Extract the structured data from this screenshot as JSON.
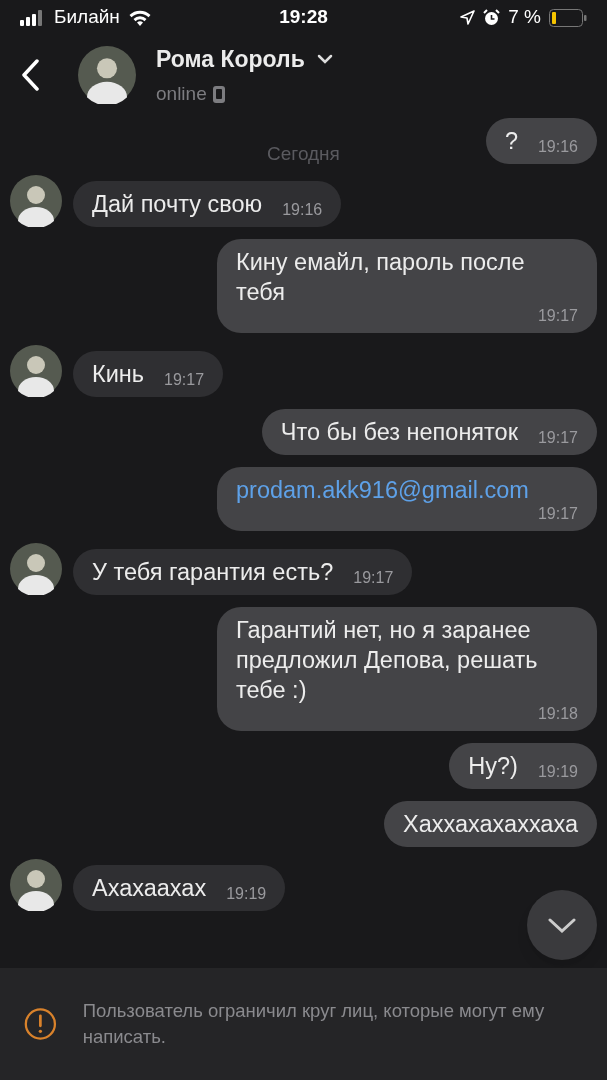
{
  "status_bar": {
    "carrier": "Билайн",
    "time": "19:28",
    "battery": "7 %"
  },
  "header": {
    "name": "Рома Король",
    "status": "online"
  },
  "date_separator": "Сегодня",
  "messages": [
    {
      "outgoing": true,
      "kind": "text",
      "text": "?",
      "time": "19:16"
    },
    {
      "outgoing": false,
      "kind": "text",
      "text": "Дай почту свою",
      "time": "19:16"
    },
    {
      "outgoing": true,
      "kind": "text",
      "text": "Кину емайл, пароль после тебя",
      "time": "19:17"
    },
    {
      "outgoing": false,
      "kind": "text",
      "text": "Кинь",
      "time": "19:17"
    },
    {
      "outgoing": true,
      "kind": "text",
      "text": "Что бы без непоняток",
      "time": "19:17"
    },
    {
      "outgoing": true,
      "kind": "link",
      "text": "prodam.akk916@gmail.com",
      "time": "19:17"
    },
    {
      "outgoing": false,
      "kind": "text",
      "text": "У тебя гарантия есть?",
      "time": "19:17"
    },
    {
      "outgoing": true,
      "kind": "text",
      "text": "Гарантий нет, но я заранее предложил Депова, решать тебе :)",
      "time": "19:18"
    },
    {
      "outgoing": true,
      "kind": "text",
      "text": "Ну?)",
      "time": "19:19"
    },
    {
      "outgoing": true,
      "kind": "text",
      "text": "Хаххахахаххаха"
    },
    {
      "outgoing": false,
      "kind": "text",
      "text": "Ахахаахах",
      "time": "19:19"
    }
  ],
  "notice": "Пользователь ограничил круг лиц, которые могут ему написать."
}
